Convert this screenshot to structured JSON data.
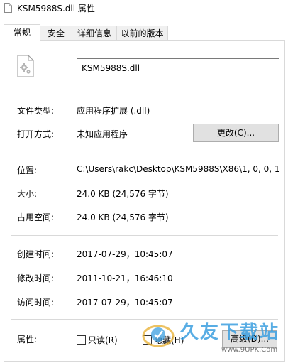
{
  "window": {
    "title": "KSM5988S.dll 属性"
  },
  "tabs": [
    {
      "label": "常规",
      "active": true
    },
    {
      "label": "安全",
      "active": false
    },
    {
      "label": "详细信息",
      "active": false
    },
    {
      "label": "以前的版本",
      "active": false
    }
  ],
  "general": {
    "file_name": "KSM5988S.dll",
    "file_type_label": "文件类型:",
    "file_type_value": "应用程序扩展 (.dll)",
    "opens_with_label": "打开方式:",
    "opens_with_value": "未知应用程序",
    "change_button": "更改(C)...",
    "location_label": "位置:",
    "location_value": "C:\\Users\\rakc\\Desktop\\KSM5988S\\X86\\1, 0, 0, 1",
    "size_label": "大小:",
    "size_value": "24.0 KB (24,576 字节)",
    "size_on_disk_label": "占用空间:",
    "size_on_disk_value": "24.0 KB (24,576 字节)",
    "created_label": "创建时间:",
    "created_value": "2017-07-29，10:45:07",
    "modified_label": "修改时间:",
    "modified_value": "2011-10-21，16:46:10",
    "accessed_label": "访问时间:",
    "accessed_value": "2017-07-29，10:45:07",
    "attributes_label": "属性:",
    "readonly_label": "只读(R)",
    "readonly_checked": false,
    "hidden_label": "隐藏(H)",
    "hidden_checked": false,
    "advanced_button": "高级(D)..."
  },
  "watermark": {
    "brand": "久友下载站",
    "url": "www.9UPK.Com"
  },
  "colors": {
    "accent": "#0078d7",
    "border": "#d9d9d9",
    "button_bg": "#e1e1e1"
  },
  "icons": {
    "title": "document-icon",
    "file": "gear-document-icon"
  }
}
